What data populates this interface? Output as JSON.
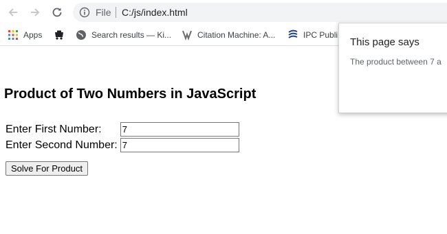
{
  "browser": {
    "omnibox": {
      "scheme_label": "File",
      "url": "C:/js/index.html"
    },
    "bookmarks": [
      {
        "label": "Apps",
        "icon": "apps-grid-icon"
      },
      {
        "label": "",
        "icon": "bookmark-favicon"
      },
      {
        "label": "Search results — Ki...",
        "icon": "globe-icon"
      },
      {
        "label": "Citation Machine: A...",
        "icon": "citation-machine-icon"
      },
      {
        "label": "IPC Publi",
        "icon": "ipc-icon"
      }
    ]
  },
  "page": {
    "title": "Product of Two Numbers in JavaScript",
    "form": {
      "first_label": "Enter First Number:",
      "first_value": "7",
      "second_label": "Enter Second Number:",
      "second_value": "7",
      "solve_label": "Solve For Product"
    }
  },
  "dialog": {
    "title": "This page says",
    "message": "The product between 7 a"
  }
}
